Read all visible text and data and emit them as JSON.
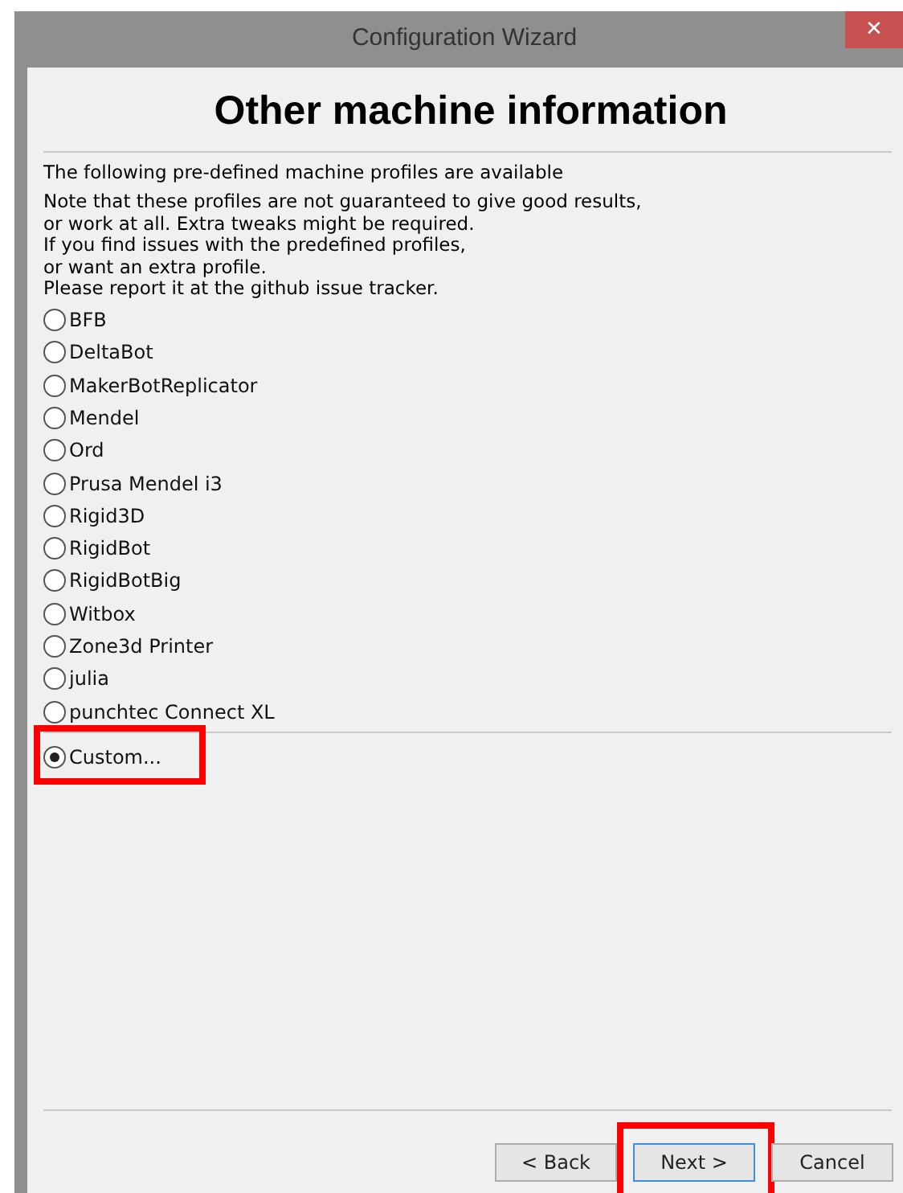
{
  "window": {
    "title": "Configuration Wizard",
    "close": "✕"
  },
  "heading": "Other machine information",
  "intro": "The following pre-defined machine profiles are available",
  "note_lines": [
    "Note that these profiles are not guaranteed to give good results,",
    "or work at all. Extra tweaks might be required.",
    "If you find issues with the predefined profiles,",
    "or want an extra profile.",
    "Please report it at the github issue tracker."
  ],
  "profiles": [
    {
      "label": "BFB",
      "selected": false
    },
    {
      "label": "DeltaBot",
      "selected": false
    },
    {
      "label": "MakerBotReplicator",
      "selected": false
    },
    {
      "label": "Mendel",
      "selected": false
    },
    {
      "label": "Ord",
      "selected": false
    },
    {
      "label": "Prusa Mendel i3",
      "selected": false
    },
    {
      "label": "Rigid3D",
      "selected": false
    },
    {
      "label": "RigidBot",
      "selected": false
    },
    {
      "label": "RigidBotBig",
      "selected": false
    },
    {
      "label": "Witbox",
      "selected": false
    },
    {
      "label": "Zone3d Printer",
      "selected": false
    },
    {
      "label": "julia",
      "selected": false
    },
    {
      "label": "punchtec Connect XL",
      "selected": false
    }
  ],
  "custom": {
    "label": "Custom...",
    "selected": true,
    "highlighted": true
  },
  "buttons": [
    {
      "label": "< Back",
      "focused": false,
      "highlighted": false
    },
    {
      "label": "Next >",
      "focused": true,
      "highlighted": true
    },
    {
      "label": "Cancel",
      "focused": false,
      "highlighted": false
    }
  ]
}
